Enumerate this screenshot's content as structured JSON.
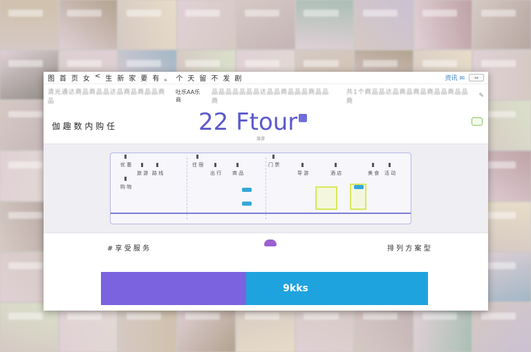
{
  "topbar": {
    "menu_items": [
      "图",
      "首",
      "页",
      "女",
      "<",
      "生",
      "新",
      "家",
      "要",
      "有",
      "。",
      "个",
      "天",
      "留",
      "不",
      "发",
      "剧"
    ],
    "right_text": "资讯 ✉",
    "window_button": "⇔"
  },
  "urlrow": {
    "left_blurred": "清光通达商品商品品达品商品商品品商品",
    "center_text": "吐乐AA乐商",
    "right_blurred": "共1个商品品达品商品商品商品品商品品商",
    "left_top_blurred": "品达品品商品品商品品商",
    "top_center_blurred": "品品品品品品品达品品商品品品商品品商",
    "right_icon": "✎",
    "bottom_icon": "☐"
  },
  "hero": {
    "site_name": "伽 趣 数 内 购 任",
    "logo_text": "22 Ftour",
    "logo_sub": "旅游"
  },
  "diagram": {
    "labels": [
      "优 惠",
      "旅 游",
      "路 线",
      "购 物",
      "住 宿",
      "出 行",
      "商 品",
      "门 票",
      "导 游",
      "酒 店",
      "美 食",
      "活 动"
    ]
  },
  "footer": {
    "left_text": "# 享 受 服 务",
    "right_text": "排 列 方 案 型"
  },
  "cta": {
    "right_label": "9kks"
  },
  "colors": {
    "accent_purple": "#5b5acb",
    "cta_left": "#7b63e0",
    "cta_right": "#1fa3df",
    "highlight": "#d8e85a"
  }
}
